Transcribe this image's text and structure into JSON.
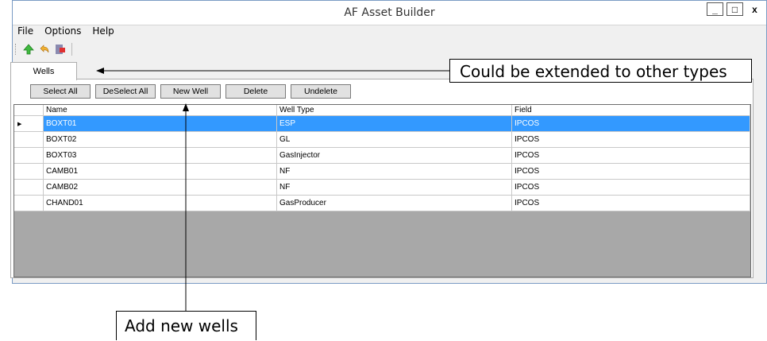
{
  "window": {
    "title": "AF Asset Builder",
    "controls": [
      "_",
      "□",
      "x"
    ]
  },
  "menu": [
    "File",
    "Options",
    "Help"
  ],
  "toolbar": {
    "icons": [
      "up-arrow-icon",
      "undo-icon",
      "exit-icon"
    ]
  },
  "tabs": [
    {
      "label": "Wells",
      "active": true
    }
  ],
  "buttons": {
    "select_all": "Select All",
    "deselect_all": "DeSelect All",
    "new_well": "New Well",
    "delete": "Delete",
    "undelete": "Undelete"
  },
  "grid": {
    "columns": [
      "Name",
      "Well Type",
      "Field"
    ],
    "rows": [
      {
        "name": "BOXT01",
        "well_type": "ESP",
        "field": "IPCOS",
        "selected": true
      },
      {
        "name": "BOXT02",
        "well_type": "GL",
        "field": "IPCOS"
      },
      {
        "name": "BOXT03",
        "well_type": "GasInjector",
        "field": "IPCOS"
      },
      {
        "name": "CAMB01",
        "well_type": "NF",
        "field": "IPCOS"
      },
      {
        "name": "CAMB02",
        "well_type": "NF",
        "field": "IPCOS"
      },
      {
        "name": "CHAND01",
        "well_type": "GasProducer",
        "field": "IPCOS"
      }
    ]
  },
  "annotations": {
    "tabs_note": "Could be extended to other types",
    "new_well_note": "Add new wells"
  },
  "colors": {
    "selection": "#3399ff",
    "grid_background": "#a8a8a8"
  }
}
